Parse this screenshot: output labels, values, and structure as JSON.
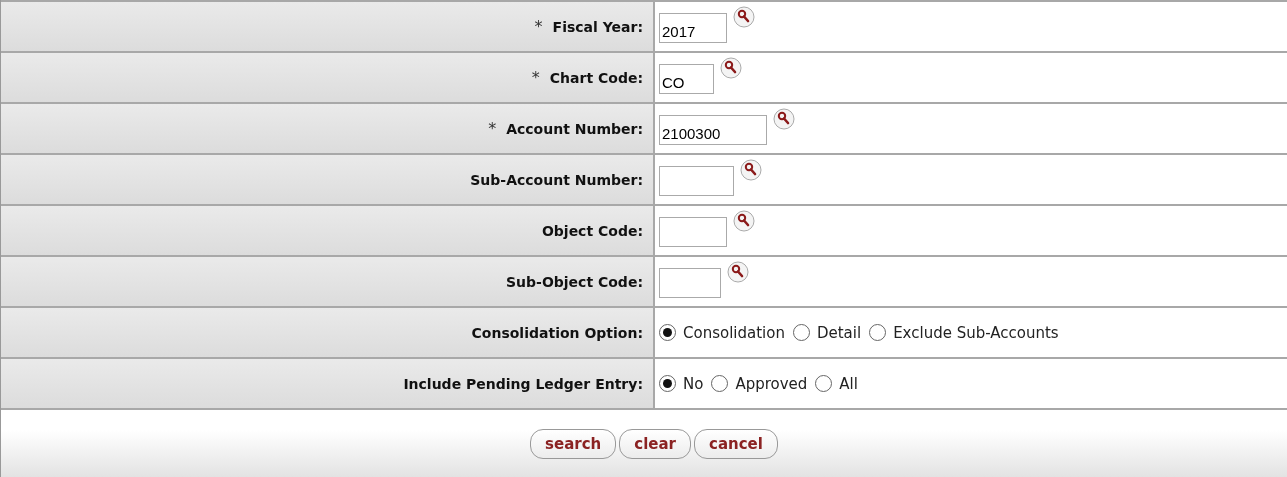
{
  "fields": [
    {
      "mark": "*",
      "label": "Fiscal Year:",
      "kind": "text",
      "value": "2017"
    },
    {
      "mark": "*",
      "label": "Chart Code:",
      "kind": "text",
      "value": "CO"
    },
    {
      "mark": "*",
      "label": "Account Number:",
      "kind": "text",
      "value": "2100300"
    },
    {
      "label": "Sub-Account Number:",
      "kind": "text"
    },
    {
      "label": "Object Code:",
      "kind": "text"
    },
    {
      "label": "Sub-Object Code:",
      "kind": "text"
    },
    {
      "label": "Consolidation Option:",
      "kind": "radio",
      "options": [
        {
          "label": "Consolidation",
          "selected": true
        },
        {
          "label": "Detail",
          "selected": false
        },
        {
          "label": "Exclude Sub-Accounts",
          "selected": false
        }
      ]
    },
    {
      "label": "Include Pending Ledger Entry:",
      "kind": "radio",
      "options": [
        {
          "label": "No",
          "selected": true
        },
        {
          "label": "Approved",
          "selected": false
        },
        {
          "label": "All",
          "selected": false
        }
      ]
    }
  ],
  "buttons": [
    "search",
    "clear",
    "cancel"
  ]
}
